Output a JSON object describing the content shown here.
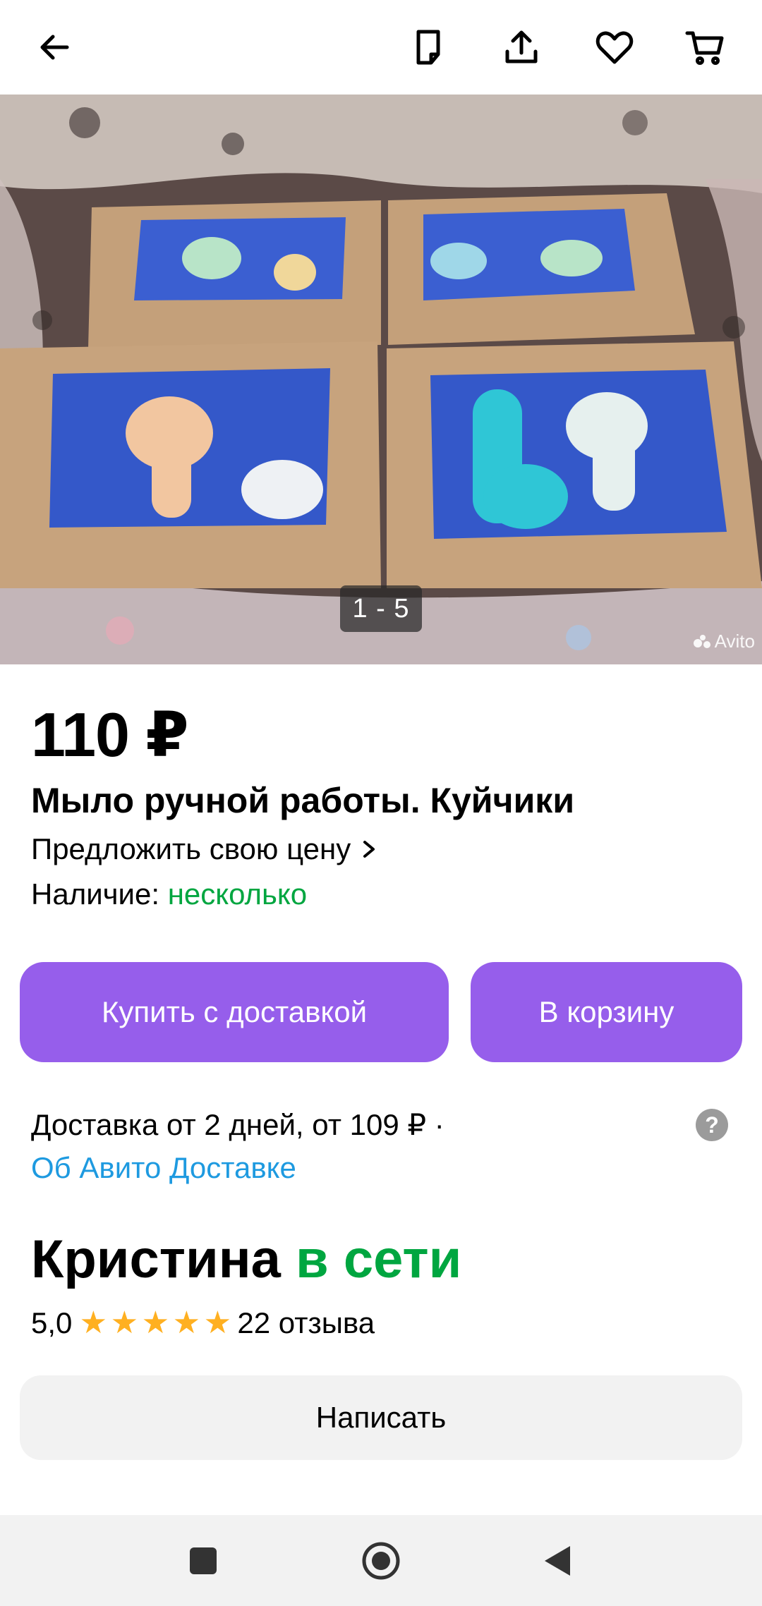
{
  "topbar": {
    "back_icon": "arrow-left-icon",
    "actions": [
      "note-icon",
      "share-icon",
      "heart-icon",
      "cart-icon"
    ]
  },
  "gallery": {
    "counter": "1 - 5",
    "watermark": "Avito"
  },
  "listing": {
    "price": "110 ₽",
    "title": "Мыло ручной работы. Куйчики",
    "offer_label": "Предложить свою цену",
    "stock_label": "Наличие:",
    "stock_value": "несколько"
  },
  "buttons": {
    "buy_with_delivery": "Купить с доставкой",
    "add_to_cart": "В корзину",
    "write": "Написать"
  },
  "delivery": {
    "text": "Доставка от 2 дней, от 109 ₽ ·",
    "link": "Об Авито Доставке",
    "help": "?"
  },
  "seller": {
    "name": "Кристина",
    "status": "в сети",
    "rating": "5,0",
    "stars": 5,
    "reviews": "22 отзыва"
  },
  "colors": {
    "accent": "#965eeb",
    "online": "#00a640",
    "link": "#1e9ae0",
    "star": "#ffb021"
  }
}
